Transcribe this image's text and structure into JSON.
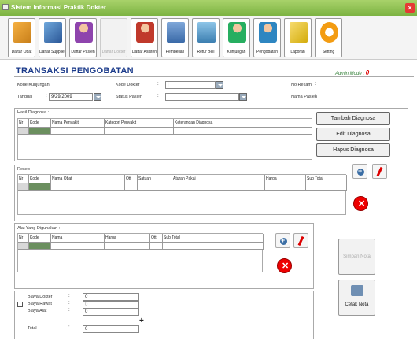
{
  "window": {
    "title": "Sistem Informasi Praktik Dokter"
  },
  "toolbar": [
    {
      "label": "Daftar Obat",
      "icon": "box-icon"
    },
    {
      "label": "Daftar Supplier",
      "icon": "supplier-icon"
    },
    {
      "label": "Daftar Pasien",
      "icon": "patient-icon"
    },
    {
      "label": "Daftar Dokter",
      "icon": "doctor-icon"
    },
    {
      "label": "Daftar Asisten",
      "icon": "assistant-icon"
    },
    {
      "label": "Pembelian",
      "icon": "purchase-icon"
    },
    {
      "label": "Retur Beli",
      "icon": "return-icon"
    },
    {
      "label": "Kunjungan",
      "icon": "visit-icon"
    },
    {
      "label": "Pengobatan",
      "icon": "treatment-icon"
    },
    {
      "label": "Laporan",
      "icon": "report-icon"
    },
    {
      "label": "Setting",
      "icon": "setting-icon"
    }
  ],
  "header": {
    "title": "TRANSAKSI PENGOBATAN",
    "admin_label": "Admin Mode",
    "admin_value": "0"
  },
  "form": {
    "kode_kunjungan": "Kode Kunjungan",
    "tanggal": "Tanggal",
    "tanggal_value": "9/29/2009",
    "kode_dokter": "Kode Dokter",
    "kode_dokter_value": "|",
    "status_pasien": "Status Pasien",
    "no_rekam": "No Rekam",
    "nama_pasien": "Nama Pasien",
    "nama_pasien_value": "_"
  },
  "diagnosa": {
    "title": "Hasil Diagnosa :",
    "cols": [
      "Nr",
      "Kode",
      "Nama Penyakit",
      "Kategori Penyakit",
      "Keterangan Diagnosa"
    ],
    "btn_tambah": "Tambah Diagnosa",
    "btn_edit": "Edit Diagnosa",
    "btn_hapus": "Hapus Diagnosa"
  },
  "resep": {
    "title": "Resep",
    "cols": [
      "Nr",
      "Kode",
      "Nama Obat",
      "Qtt",
      "Satuan",
      "Aturan Pakai",
      "Harga",
      "Sub Total"
    ]
  },
  "alat": {
    "title": "Alat Yang Digunakan :",
    "cols": [
      "Nr",
      "Kode",
      "Nama",
      "Harga",
      "Qtt",
      "Sub Total"
    ]
  },
  "biaya": {
    "dokter": "Biaya Dokter",
    "dokter_value": "0",
    "rawat": "Biaya Rawat",
    "rawat_value": "0",
    "alat": "Biaya Alat",
    "alat_value": "0",
    "total": "Total",
    "total_value": "0"
  },
  "actions": {
    "simpan": "Simpan Nota",
    "cetak": "Cetak Nota"
  }
}
